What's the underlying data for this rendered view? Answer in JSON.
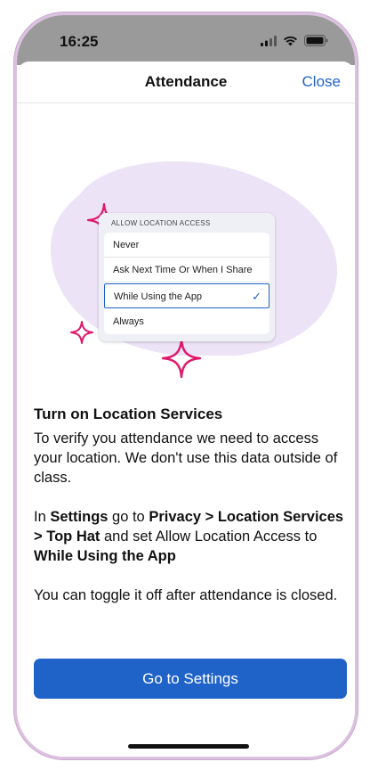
{
  "status": {
    "time": "16:25"
  },
  "nav": {
    "title": "Attendance",
    "close_label": "Close"
  },
  "illustration": {
    "header": "ALLOW LOCATION ACCESS",
    "options": [
      {
        "label": "Never",
        "selected": false
      },
      {
        "label": "Ask Next Time Or When I Share",
        "selected": false
      },
      {
        "label": "While Using the App",
        "selected": true
      },
      {
        "label": "Always",
        "selected": false
      }
    ],
    "check_glyph": "✓",
    "blob_color": "#ece3f7",
    "sparkle_color": "#e0186b"
  },
  "content": {
    "heading": "Turn on Location Services",
    "para1": "To verify you attendance we need to access your location. We don't use this data outside of class.",
    "para2": {
      "t1": "In ",
      "b1": "Settings",
      "t2": " go to ",
      "b2": "Privacy > Location Services > Top Hat",
      "t3": " and set Allow Location Access to ",
      "b3": "While Using the App"
    },
    "para3": "You can toggle it off after attendance is closed."
  },
  "button": {
    "label": "Go to Settings",
    "color": "#1f63c9"
  }
}
